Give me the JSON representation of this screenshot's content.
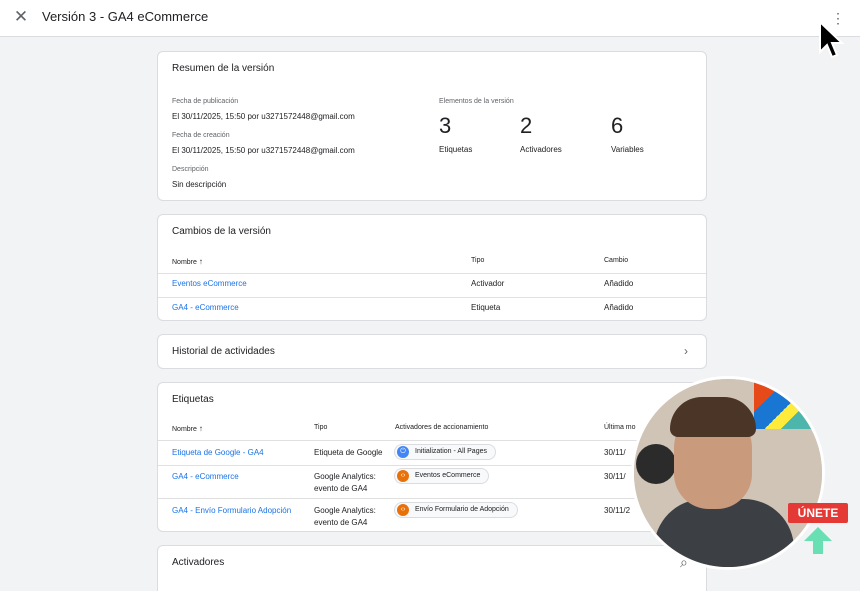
{
  "header": {
    "close_icon": "✕",
    "title": "Versión 3 - GA4 eCommerce",
    "more_icon": "⋮"
  },
  "summary": {
    "title": "Resumen de la versión",
    "pub_label": "Fecha de publicación",
    "pub_value": "El 30/11/2025, 15:50 por u3271572448@gmail.com",
    "created_label": "Fecha de creación",
    "created_value": "El 30/11/2025, 15:50 por u3271572448@gmail.com",
    "desc_label": "Descripción",
    "desc_value": "Sin descripción",
    "elements_label": "Elementos de la versión",
    "stats": [
      {
        "value": "3",
        "label": "Etiquetas"
      },
      {
        "value": "2",
        "label": "Activadores"
      },
      {
        "value": "6",
        "label": "Variables"
      }
    ]
  },
  "changes": {
    "title": "Cambios de la versión",
    "col_name": "Nombre",
    "col_type": "Tipo",
    "col_change": "Cambio",
    "sort_icon": "↑",
    "rows": [
      {
        "name": "Eventos eCommerce",
        "type": "Activador",
        "change": "Añadido"
      },
      {
        "name": "GA4 - eCommerce",
        "type": "Etiqueta",
        "change": "Añadido"
      }
    ]
  },
  "history": {
    "title": "Historial de actividades",
    "chevron_icon": "›"
  },
  "tags": {
    "title": "Etiquetas",
    "col_name": "Nombre",
    "col_type": "Tipo",
    "col_triggers": "Activadores de accionamiento",
    "col_modified": "Última mo",
    "sort_icon": "↑",
    "rows": [
      {
        "name": "Etiqueta de Google - GA4",
        "type1": "Etiqueta de Google",
        "type2": "",
        "trigger": "Initialization - All Pages",
        "trigger_icon": "⏻",
        "modified": "30/11/"
      },
      {
        "name": "GA4 - eCommerce",
        "type1": "Google Analytics:",
        "type2": "evento de GA4",
        "trigger": "Eventos eCommerce",
        "trigger_icon": "‹›",
        "modified": "30/11/"
      },
      {
        "name": "GA4 - Envío Formulario Adopción",
        "type1": "Google Analytics:",
        "type2": "evento de GA4",
        "trigger": "Envío Formulario de Adopción",
        "trigger_icon": "‹›",
        "modified": "30/11/2"
      }
    ]
  },
  "triggers": {
    "title": "Activadores",
    "search_icon": "⌕"
  },
  "overlay": {
    "join_label": "ÚNETE"
  },
  "colors": {
    "link": "#1a73e8",
    "accent_orange": "#e8710a",
    "accent_blue": "#4285f4",
    "join_red": "#e53935",
    "arrow_green": "#69e0b4"
  }
}
